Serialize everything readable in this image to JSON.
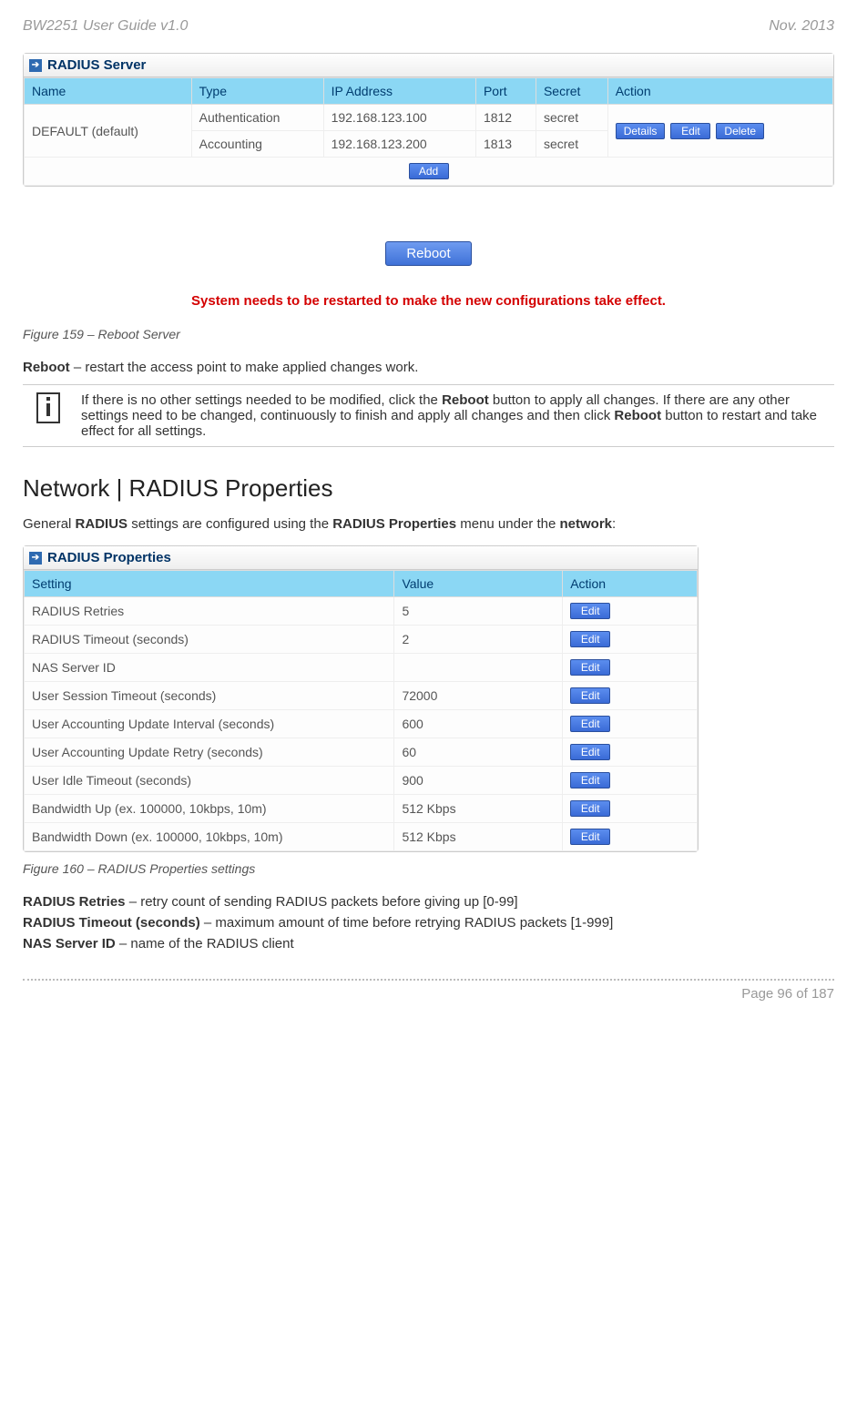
{
  "header": {
    "left": "BW2251 User Guide v1.0",
    "right": "Nov.  2013"
  },
  "radius_server": {
    "title": "RADIUS Server",
    "columns": [
      "Name",
      "Type",
      "IP Address",
      "Port",
      "Secret",
      "Action"
    ],
    "name_cell": "DEFAULT (default)",
    "rows": [
      {
        "type": "Authentication",
        "ip": "192.168.123.100",
        "port": "1812",
        "secret": "secret"
      },
      {
        "type": "Accounting",
        "ip": "192.168.123.200",
        "port": "1813",
        "secret": "secret"
      }
    ],
    "action_buttons": {
      "details": "Details",
      "edit": "Edit",
      "delete": "Delete"
    },
    "add": "Add"
  },
  "reboot": {
    "button": "Reboot",
    "message": "System needs to be restarted to make the new configurations take effect."
  },
  "fig159": "Figure 159 – Reboot Server",
  "reboot_desc": {
    "label": "Reboot",
    "text": " – restart the access point to make applied changes work."
  },
  "info_note": {
    "p1a": "If there is no other settings needed to be modified, click the ",
    "b1": "Reboot",
    "p1b": " button to apply all changes. If there are any other settings need to be changed, continuously to finish and apply all changes and then click ",
    "b2": "Reboot",
    "p1c": " button to restart and take effect  for all settings."
  },
  "section_title": "Network | RADIUS Properties",
  "section_intro": {
    "a": "General ",
    "b": "RADIUS",
    "c": " settings are configured using the ",
    "d": "RADIUS Properties",
    "e": " menu under the ",
    "f": "network",
    "g": ":"
  },
  "radius_props": {
    "title": "RADIUS Properties",
    "columns": [
      "Setting",
      "Value",
      "Action"
    ],
    "edit": "Edit",
    "rows": [
      {
        "s": "RADIUS Retries",
        "v": "5"
      },
      {
        "s": "RADIUS Timeout (seconds)",
        "v": "2"
      },
      {
        "s": "NAS Server ID",
        "v": ""
      },
      {
        "s": "User Session Timeout (seconds)",
        "v": "72000"
      },
      {
        "s": "User Accounting Update Interval (seconds)",
        "v": "600"
      },
      {
        "s": "User Accounting Update Retry (seconds)",
        "v": "60"
      },
      {
        "s": "User Idle Timeout (seconds)",
        "v": "900"
      },
      {
        "s": "Bandwidth Up (ex. 100000, 10kbps, 10m)",
        "v": "512 Kbps"
      },
      {
        "s": "Bandwidth Down (ex. 100000, 10kbps, 10m)",
        "v": "512 Kbps"
      }
    ]
  },
  "fig160": "Figure 160 – RADIUS Properties settings",
  "defs": {
    "d1": {
      "b": "RADIUS Retries",
      "t": " – retry count of sending RADIUS packets before giving up [0-99]"
    },
    "d2": {
      "b": "RADIUS Timeout (seconds)",
      "t": " – maximum amount of time before retrying RADIUS packets [1-999]"
    },
    "d3": {
      "b": "NAS Server ID",
      "t": " – name of the RADIUS client"
    }
  },
  "footer": "Page 96 of 187"
}
